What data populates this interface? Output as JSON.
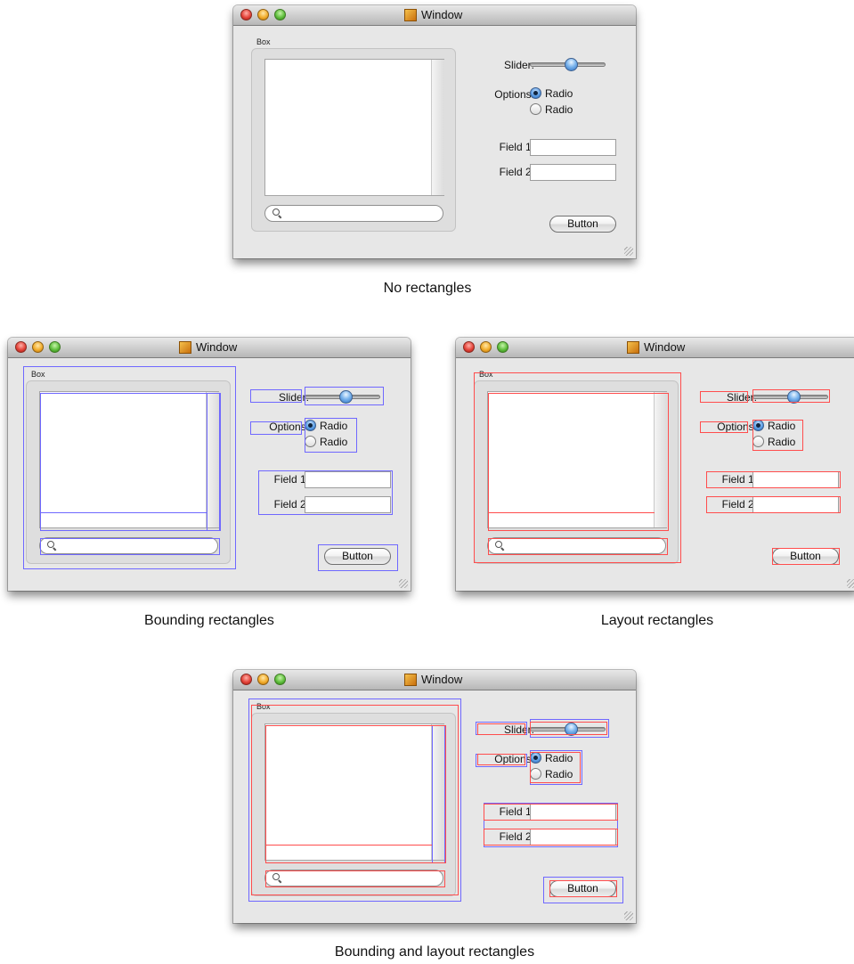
{
  "window": {
    "title": "Window",
    "box_label": "Box",
    "slider_label": "Slider:",
    "slider_value": 0.55,
    "options_label": "Options:",
    "radio_options": [
      "Radio",
      "Radio"
    ],
    "selected_radio": 0,
    "field1_label": "Field 1:",
    "field2_label": "Field 2:",
    "field1_value": "",
    "field2_value": "",
    "search_value": "",
    "button_label": "Button"
  },
  "captions": {
    "none": "No rectangles",
    "bounding": "Bounding rectangles",
    "layout": "Layout rectangles",
    "both": "Bounding and layout rectangles"
  },
  "colors": {
    "bounding": "#6f68ff",
    "layout": "#ff4d4d"
  }
}
